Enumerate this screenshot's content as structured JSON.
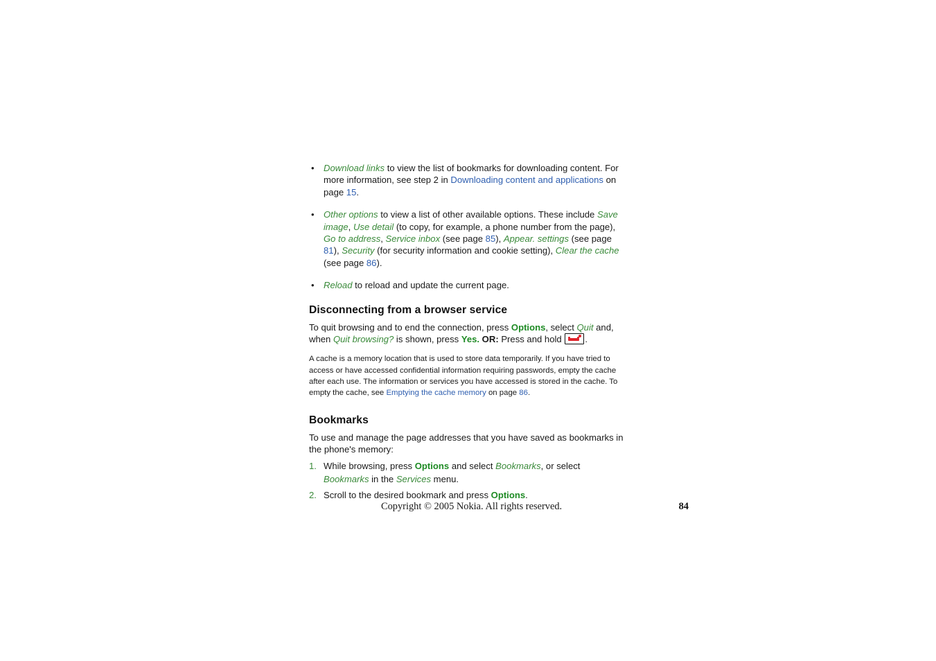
{
  "document": {
    "page_number": "84",
    "copyright": "Copyright © 2005 Nokia. All rights reserved."
  },
  "colors": {
    "ui_term_green": "#3a8a3a",
    "softkey_green": "#1f8b25",
    "cross_reference_blue": "#2f5fb0",
    "body_text": "#1a1a1a",
    "key_icon_red": "#e0222a"
  },
  "bullets": [
    {
      "term": "Download links",
      "text_1": " to view the list of bookmarks for downloading content. For more information, see step 2 in ",
      "link_1": "Downloading content and applications",
      "text_2": " on page ",
      "link_2": "15",
      "text_3": "."
    },
    {
      "term": "Other options",
      "t1": " to view a list of other available options. These include ",
      "term_2": "Save image",
      "t2": ", ",
      "term_3": "Use detail",
      "t3": " (to copy, for example, a phone number from the page), ",
      "term_4": "Go to address",
      "t4": ", ",
      "term_5": "Service inbox",
      "t5": " (see page ",
      "link_1": "85",
      "t6": "), ",
      "term_6": "Appear. settings",
      "t7": " (see page ",
      "link_2": "81",
      "t8": "), ",
      "term_7": "Security",
      "t9": " (for security information and cookie setting), ",
      "term_8": "Clear the cache",
      "t10": " (see page ",
      "link_3": "86",
      "t11": ")."
    },
    {
      "term": "Reload",
      "text_1": " to reload and update the current page."
    }
  ],
  "section_disconnecting": {
    "heading": "Disconnecting from a browser service",
    "p1_t1": "To quit browsing and to end the connection, press ",
    "p1_softkey_1": "Options",
    "p1_t2": ", select ",
    "p1_term_1": "Quit",
    "p1_t3": " and, when ",
    "p1_term_2": "Quit browsing?",
    "p1_t4": " is shown, press ",
    "p1_softkey_2": "Yes.",
    "p1_t5": " ",
    "p1_bold_1": "OR:",
    "p1_t6": " Press and hold ",
    "p1_key_icon": "end-call-key-icon",
    "p1_t7": ".",
    "note_t1": "A cache is a memory location that is used to store data temporarily. If you have tried to access or have accessed confidential information requiring passwords, empty the cache after each use. The information or services you have accessed is stored in the cache. To empty the cache, see ",
    "note_link_1": "Emptying the cache memory",
    "note_t2": " on page ",
    "note_link_2": "86",
    "note_t3": "."
  },
  "section_bookmarks": {
    "heading": "Bookmarks",
    "intro": "To use and manage the page addresses that you have saved as bookmarks in the phone's memory:",
    "steps": [
      {
        "marker": "1.",
        "t1": "While browsing, press ",
        "softkey_1": "Options",
        "t2": " and select ",
        "term_1": "Bookmarks",
        "t3": ", or select ",
        "term_2": "Bookmarks",
        "t4": " in the ",
        "term_3": "Services",
        "t5": " menu."
      },
      {
        "marker": "2.",
        "t1": "Scroll to the desired bookmark and press ",
        "softkey_1": "Options",
        "t2": "."
      }
    ]
  }
}
